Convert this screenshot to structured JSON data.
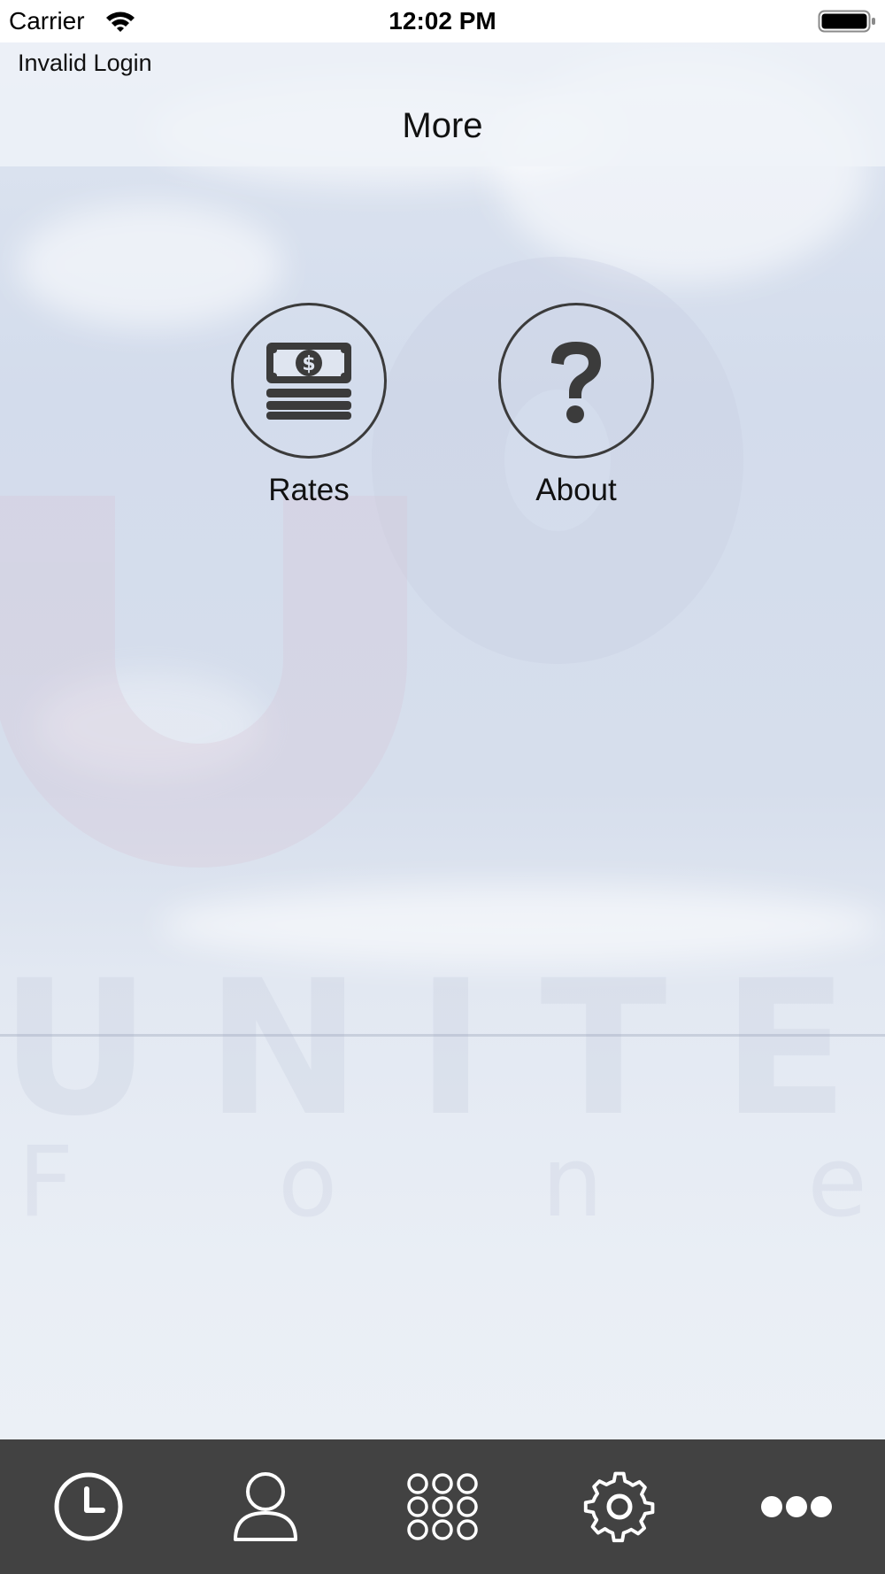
{
  "status_bar": {
    "carrier": "Carrier",
    "time": "12:02 PM",
    "icons": [
      "wifi-icon",
      "battery-icon"
    ]
  },
  "header": {
    "notice": "Invalid Login",
    "title": "More"
  },
  "menu": {
    "items": [
      {
        "label": "Rates",
        "icon": "money-stack-icon"
      },
      {
        "label": "About",
        "icon": "question-mark-icon"
      }
    ]
  },
  "tab_bar": {
    "tabs": [
      {
        "icon": "clock-icon"
      },
      {
        "icon": "contact-icon"
      },
      {
        "icon": "keypad-icon"
      },
      {
        "icon": "gear-icon"
      },
      {
        "icon": "more-dots-icon"
      }
    ]
  },
  "colors": {
    "tab_bar_background": "#424242",
    "tab_icon": "#ffffff",
    "menu_icon": "#3b3b3b",
    "header_background": "#f0f3f8"
  }
}
